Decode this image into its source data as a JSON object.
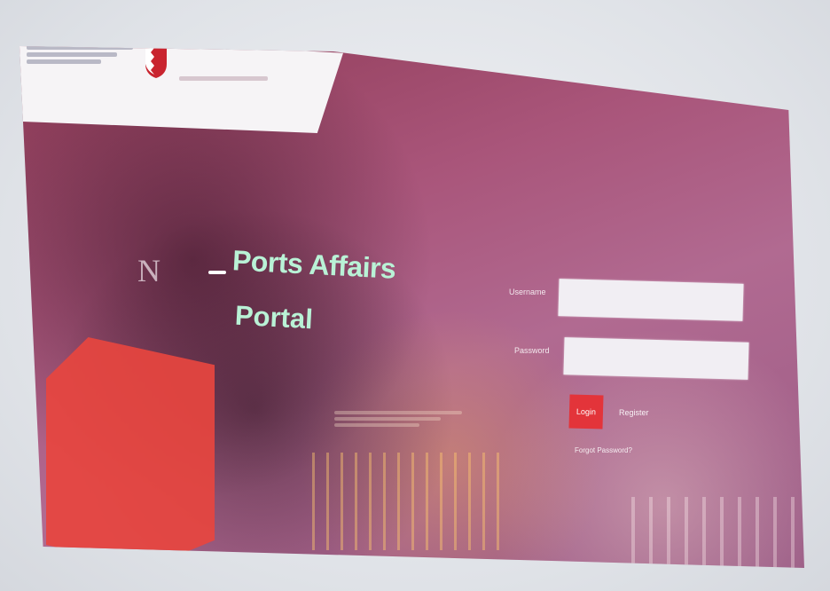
{
  "portal": {
    "title_line1": "Ports Affairs",
    "title_line2": "Portal"
  },
  "login_form": {
    "username_label": "Username",
    "password_label": "Password",
    "username_placeholder": "",
    "password_placeholder": "",
    "login_button_label": "Login",
    "register_label": "Register",
    "forgot_password_label": "Forgot Password?"
  },
  "colors": {
    "title_accent": "#b9f2d6",
    "login_button": "#e3343a",
    "hexagon_accent": "#e7453f"
  },
  "icons": {
    "emblem": "bahrain-emblem-icon"
  }
}
